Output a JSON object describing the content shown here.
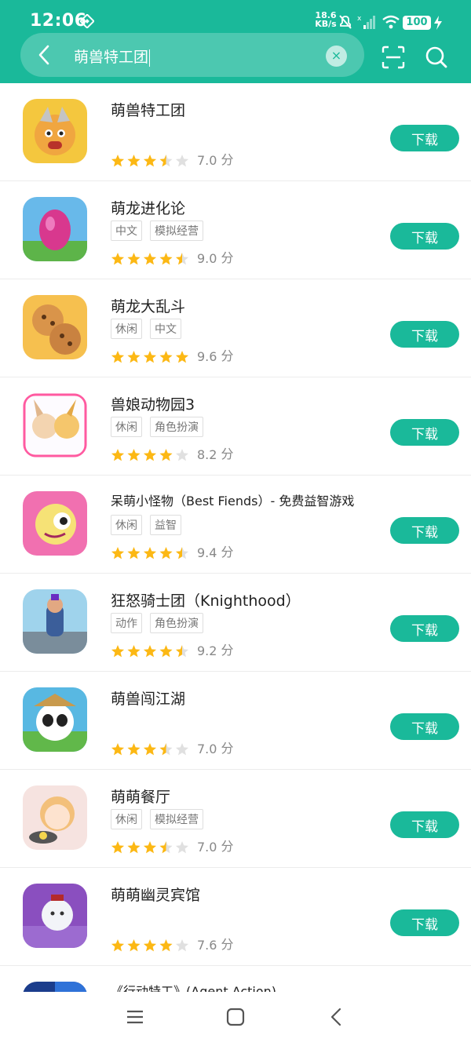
{
  "status": {
    "time": "12:06",
    "speed_value": "18.6",
    "speed_unit": "KB/s",
    "battery": "100"
  },
  "search": {
    "query": "萌兽特工团"
  },
  "rating_unit": "分",
  "download_label": "下载",
  "colors": {
    "accent": "#1ab99a",
    "star": "#fcb814",
    "star_empty": "#e0e0e0"
  },
  "apps": [
    {
      "title": "萌兽特工团",
      "tags": [],
      "score": "7.0",
      "stars": 3.5
    },
    {
      "title": "萌龙进化论",
      "tags": [
        "中文",
        "模拟经营"
      ],
      "score": "9.0",
      "stars": 4.5
    },
    {
      "title": "萌龙大乱斗",
      "tags": [
        "休闲",
        "中文"
      ],
      "score": "9.6",
      "stars": 5
    },
    {
      "title": "兽娘动物园3",
      "tags": [
        "休闲",
        "角色扮演"
      ],
      "score": "8.2",
      "stars": 4
    },
    {
      "title": "呆萌小怪物（Best Fiends）- 免费益智游戏",
      "tags": [
        "休闲",
        "益智"
      ],
      "score": "9.4",
      "stars": 4.5
    },
    {
      "title": "狂怒骑士团（Knighthood）",
      "tags": [
        "动作",
        "角色扮演"
      ],
      "score": "9.2",
      "stars": 4.5
    },
    {
      "title": "萌兽闯江湖",
      "tags": [],
      "score": "7.0",
      "stars": 3.5
    },
    {
      "title": "萌萌餐厅",
      "tags": [
        "休闲",
        "模拟经营"
      ],
      "score": "7.0",
      "stars": 3.5
    },
    {
      "title": "萌萌幽灵宾馆",
      "tags": [],
      "score": "7.6",
      "stars": 4
    },
    {
      "title": "《行动特工》(Agent Action)",
      "tags": [],
      "score": "",
      "stars": 0
    }
  ]
}
